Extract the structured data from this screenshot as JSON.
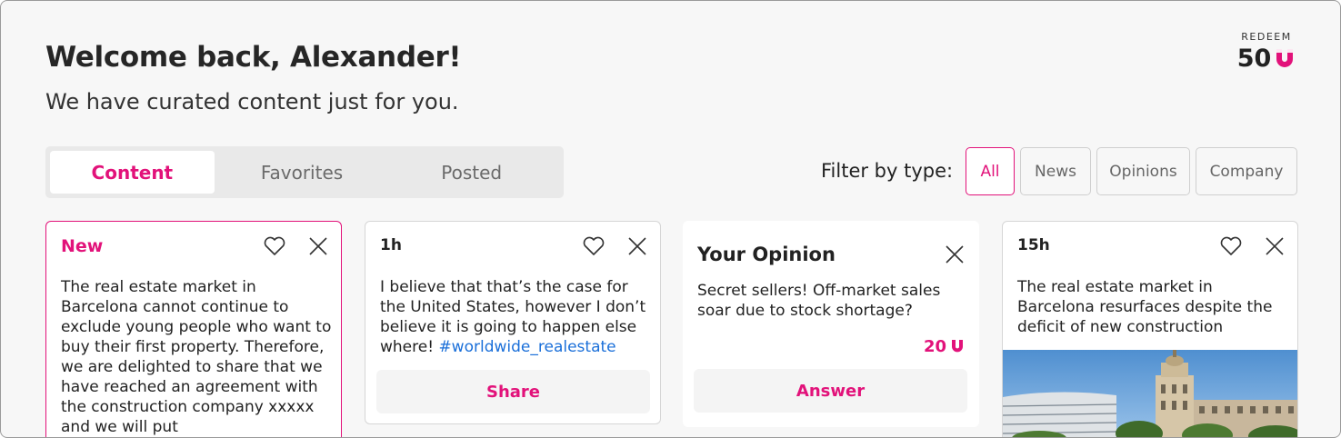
{
  "header": {
    "title": "Welcome back, Alexander!",
    "subtitle": "We have curated content just for you."
  },
  "redeem": {
    "label": "REDEEM",
    "value": "50",
    "icon": "u-coin-icon"
  },
  "tabs": [
    {
      "label": "Content",
      "active": true
    },
    {
      "label": "Favorites",
      "active": false
    },
    {
      "label": "Posted",
      "active": false
    }
  ],
  "filter": {
    "label": "Filter by type:",
    "options": [
      {
        "label": "All",
        "active": true
      },
      {
        "label": "News",
        "active": false
      },
      {
        "label": "Opinions",
        "active": false
      },
      {
        "label": "Company",
        "active": false
      }
    ]
  },
  "cards": [
    {
      "head": "New",
      "text": "The real estate market in Barcelona cannot continue to exclude young people who want to buy their first property. Therefore, we are delighted to share that we have reached an agreement with the construction company xxxxx and we will put"
    },
    {
      "head": "1h",
      "text": "I believe that that’s the case for the United States, however I don’t believe it is going to happen else where!",
      "hashtag": "#worldwide_realestate",
      "action": "Share"
    },
    {
      "head": "Your Opinion",
      "text": "Secret sellers! Off-market sales soar due to stock shortage?",
      "reward": "20",
      "action": "Answer"
    },
    {
      "head": "15h",
      "text": "The real estate market in Barcelona resurfaces despite the deficit of new construction"
    }
  ],
  "colors": {
    "accent": "#e2127a",
    "link": "#1a6fd9",
    "background": "#f7f7f7"
  }
}
